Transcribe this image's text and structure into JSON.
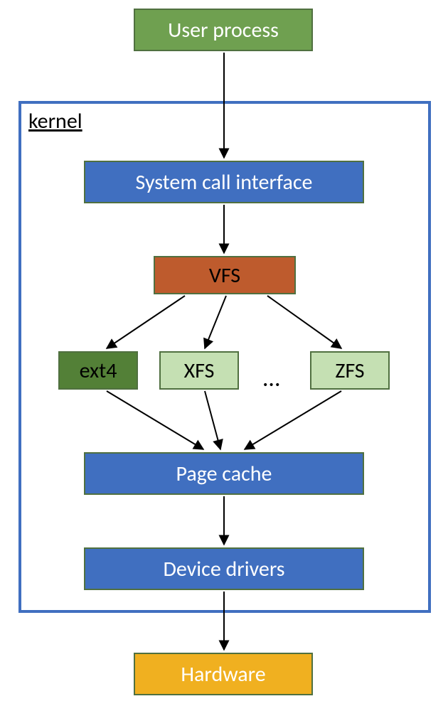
{
  "boxes": {
    "user_process": {
      "label": "User process",
      "bg": "#6FA050",
      "fg": "#ffffff",
      "font": 30
    },
    "kernel_frame": {
      "label": "kernel",
      "border": "#406FC0",
      "font": 30
    },
    "syscall": {
      "label": "System call interface",
      "bg": "#406FC0",
      "fg": "#ffffff",
      "font": 30
    },
    "vfs": {
      "label": "VFS",
      "bg": "#BE5B2D",
      "fg": "#000000",
      "font": 30
    },
    "ext4": {
      "label": "ext4",
      "bg": "#538037",
      "fg": "#000000",
      "font": 30
    },
    "xfs": {
      "label": "XFS",
      "bg": "#C5E0B3",
      "fg": "#000000",
      "font": 30
    },
    "zfs": {
      "label": "ZFS",
      "bg": "#C5E0B3",
      "fg": "#000000",
      "font": 30
    },
    "dots": {
      "label": "…",
      "fg": "#000000",
      "font": 34
    },
    "page_cache": {
      "label": "Page cache",
      "bg": "#406FC0",
      "fg": "#ffffff",
      "font": 30
    },
    "device_drv": {
      "label": "Device drivers",
      "bg": "#406FC0",
      "fg": "#ffffff",
      "font": 30
    },
    "hardware": {
      "label": "Hardware",
      "bg": "#F0B020",
      "fg": "#ffffff",
      "font": 30
    }
  }
}
